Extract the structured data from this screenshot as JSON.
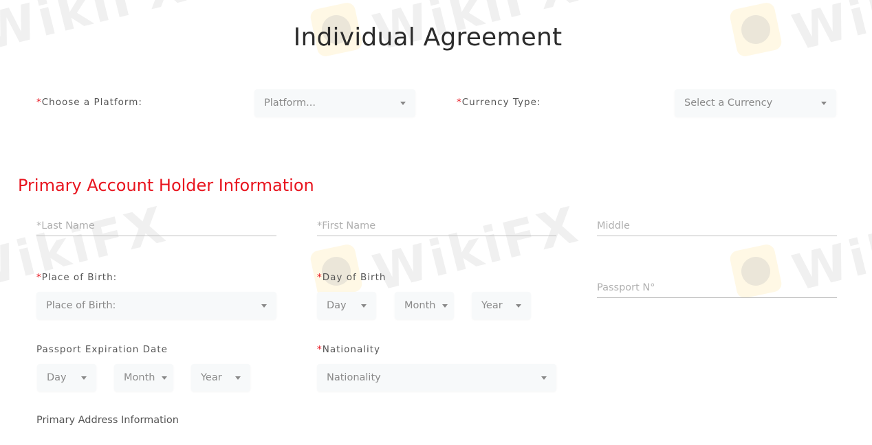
{
  "watermark": {
    "text": "WikiFX"
  },
  "page_title": "Individual Agreement",
  "platform": {
    "label": "Choose a Platform:",
    "required_mark": "*",
    "selected": "Platform..."
  },
  "currency": {
    "label": "Currency Type:",
    "required_mark": "*",
    "selected": "Select a Currency"
  },
  "primary_section": {
    "title": "Primary Account Holder Information",
    "last_name": {
      "placeholder": "*Last Name",
      "value": ""
    },
    "first_name": {
      "placeholder": "*First Name",
      "value": ""
    },
    "middle_name": {
      "placeholder": "Middle",
      "value": ""
    },
    "place_of_birth": {
      "label": "Place of Birth:",
      "required_mark": "*",
      "selected": "Place of Birth:"
    },
    "day_of_birth": {
      "label": "Day of Birth",
      "required_mark": "*",
      "day": "Day",
      "month": "Month",
      "year": "Year"
    },
    "passport_number": {
      "placeholder": "Passport N°",
      "value": ""
    },
    "passport_expiration": {
      "label": "Passport Expiration Date",
      "day": "Day",
      "month": "Month",
      "year": "Year"
    },
    "nationality": {
      "label": "Nationality",
      "required_mark": "*",
      "selected": "Nationality"
    }
  },
  "address_section": {
    "title": "Primary Address Information"
  },
  "colors": {
    "accent_red": "#e8141e",
    "title_text": "#2b2b2b",
    "select_bg": "#f7f9fa"
  }
}
